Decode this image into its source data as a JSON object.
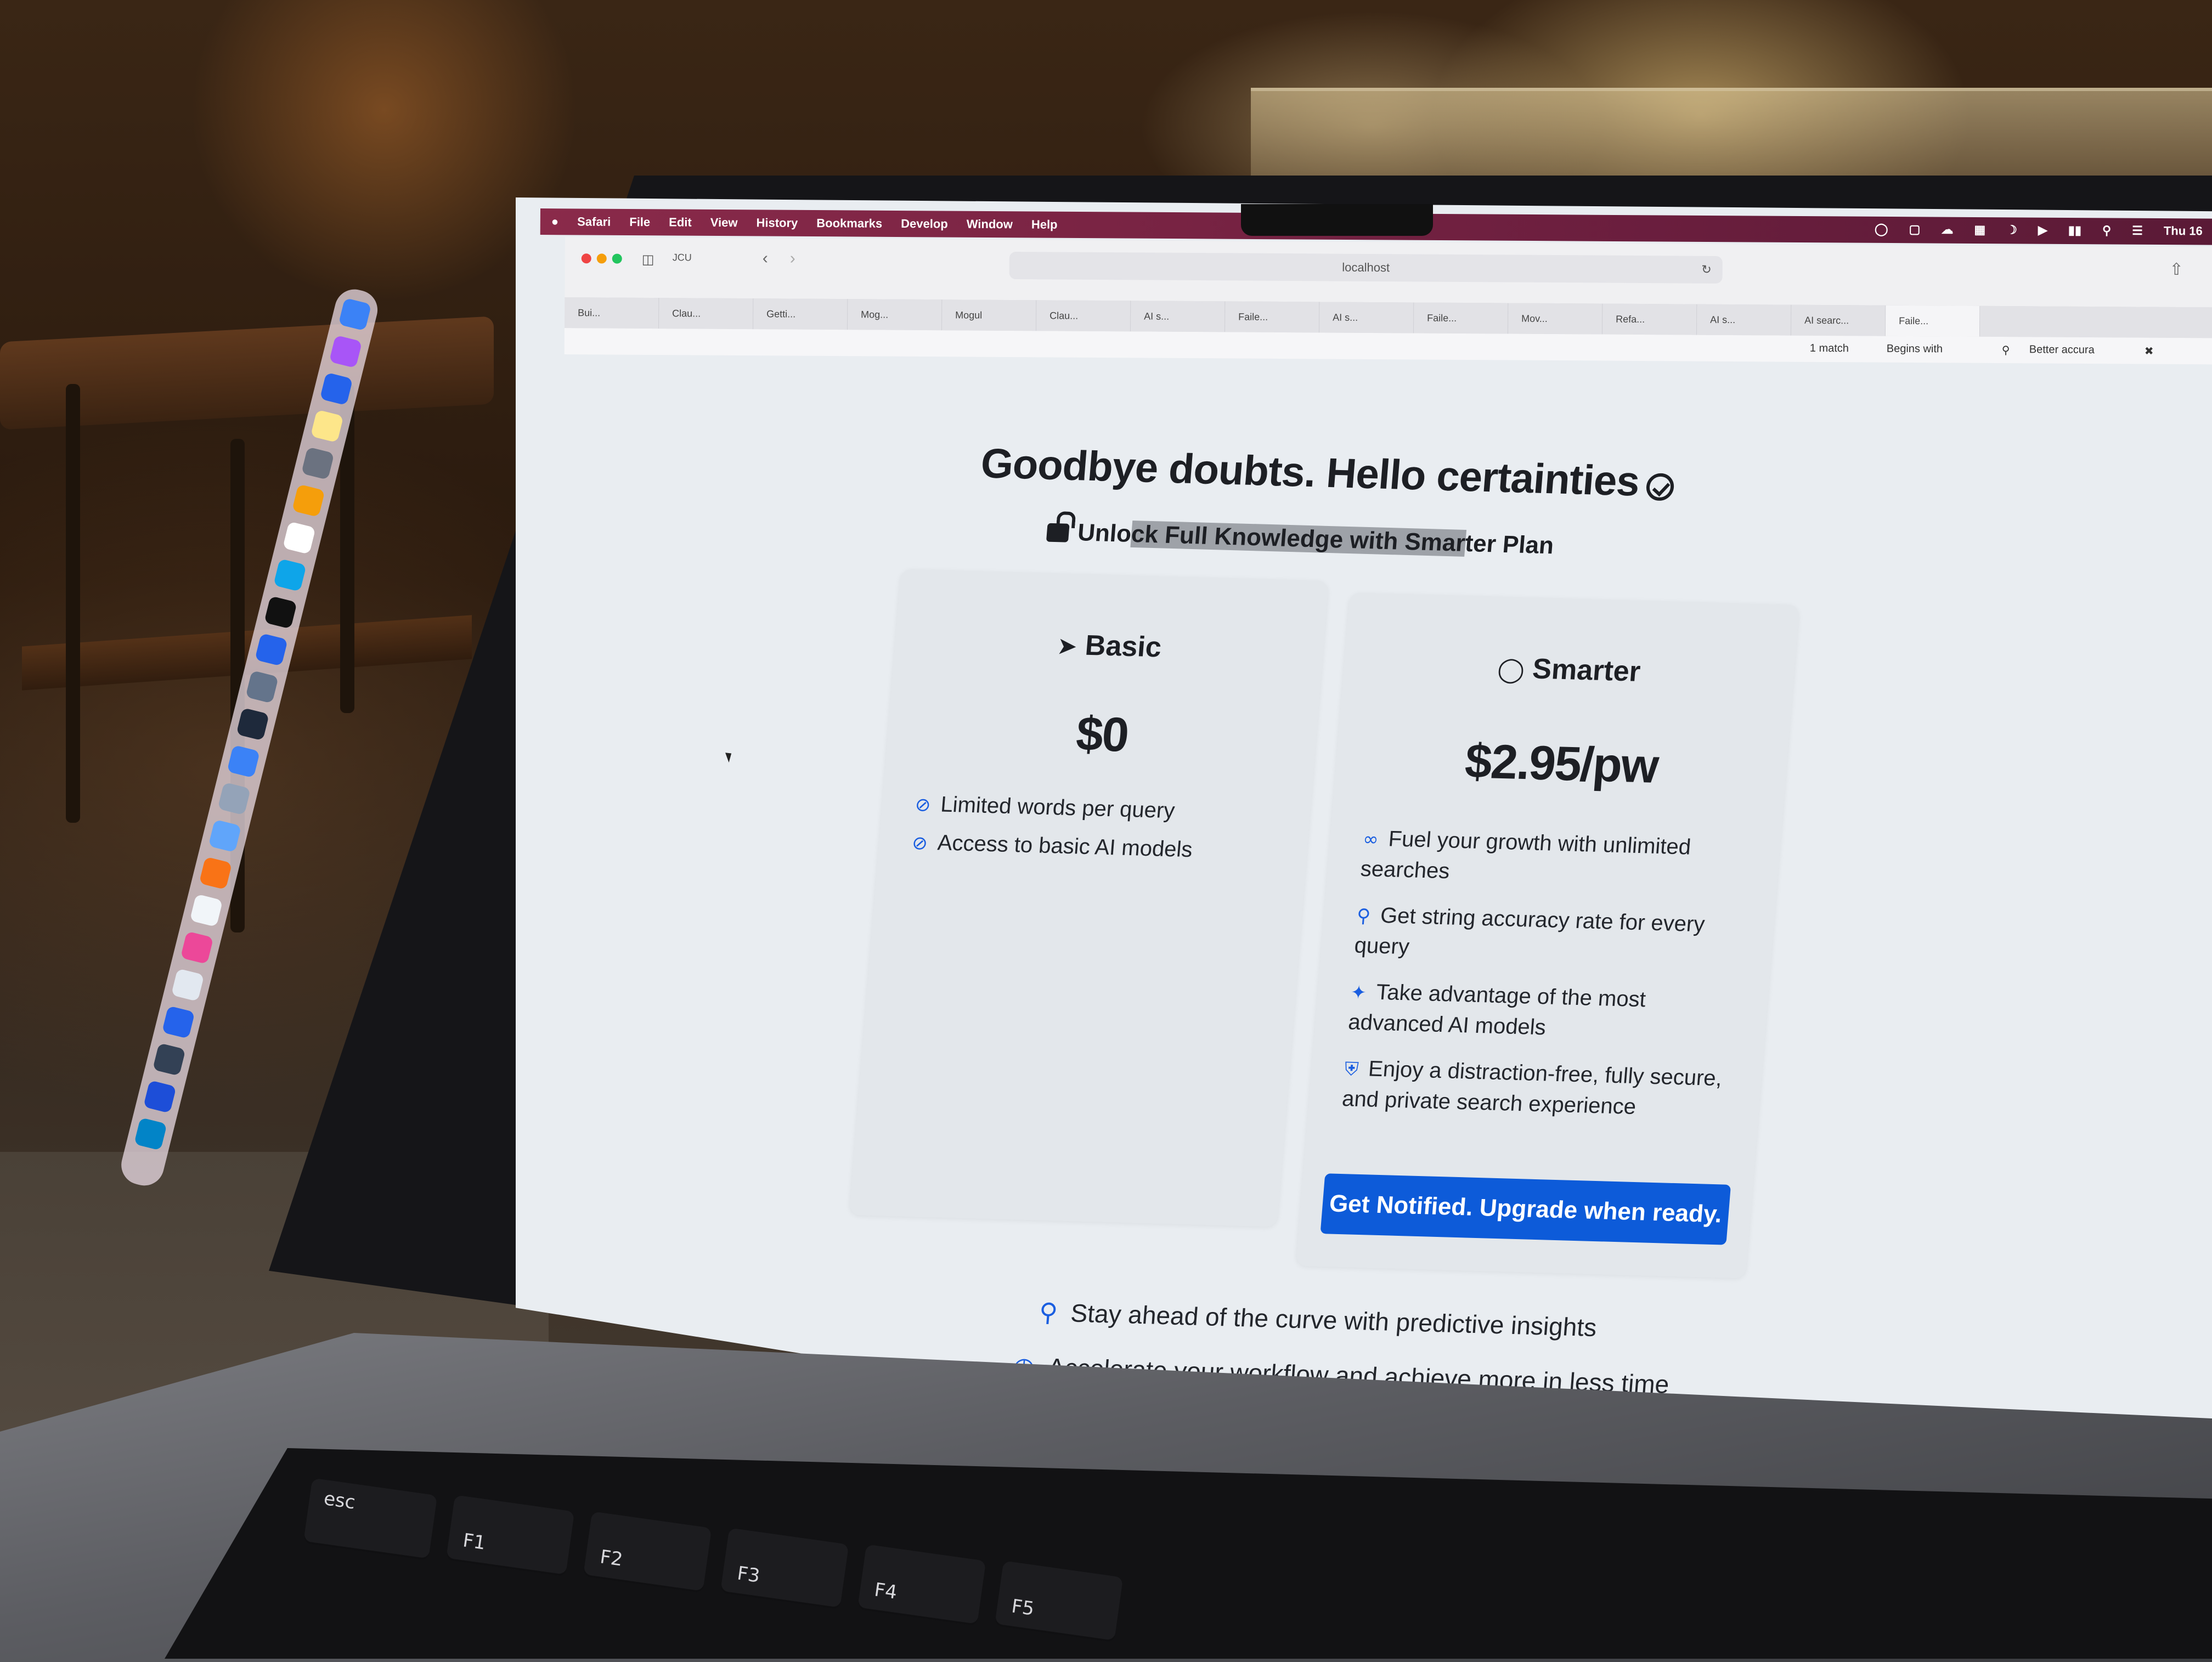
{
  "menubar": {
    "app": "Safari",
    "items": [
      "File",
      "Edit",
      "View",
      "History",
      "Bookmarks",
      "Develop",
      "Window",
      "Help"
    ],
    "clock": "Thu 16"
  },
  "browser": {
    "profile": "JCU",
    "url": "localhost",
    "tabs": [
      "Bui...",
      "Clau...",
      "Getti...",
      "Mog...",
      "Mogul",
      "Clau...",
      "AI s...",
      "Faile...",
      "AI s...",
      "Faile...",
      "Mov...",
      "Refa...",
      "AI s...",
      "AI searc...",
      "Faile..."
    ],
    "find": {
      "count": "1 match",
      "mode": "Begins with",
      "query": "Better accura"
    }
  },
  "hero": {
    "title": "Goodbye doubts. Hello certainties",
    "subtitle_pre": "Unlo",
    "subtitle_highlight": "ck Full Knowledge with Smar",
    "subtitle_post": "ter Plan"
  },
  "plans": {
    "basic": {
      "name": "Basic",
      "price": "$0",
      "features": [
        "Limited words per query",
        "Access to basic AI models"
      ]
    },
    "smarter": {
      "name": "Smarter",
      "price": "$2.95/pw",
      "features": [
        "Fuel your growth with unlimited searches",
        "Get string accuracy rate for every query",
        "Take advantage of the most advanced AI models",
        "Enjoy a distraction-free, fully secure, and private search experience"
      ],
      "cta": "Get Notified. Upgrade when ready."
    }
  },
  "benefits": [
    "Stay ahead of the curve with predictive insights",
    "Accelerate your workflow and achieve more in less time"
  ],
  "keys": {
    "esc": "esc",
    "f1": "F1",
    "f2": "F2",
    "f3": "F3",
    "f4": "F4",
    "f5": "F5"
  }
}
